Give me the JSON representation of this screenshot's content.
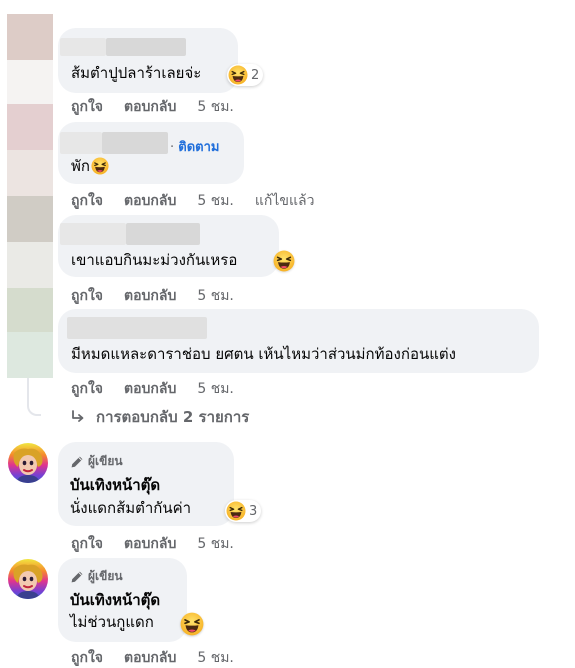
{
  "comments": [
    {
      "text": "ส้มตำปูปลาร้าเลยจ่ะ",
      "reaction_count": "2",
      "like": "ถูกใจ",
      "reply": "ตอบกลับ",
      "time": "5 ชม."
    },
    {
      "follow": "ติดตาม",
      "text": "พัก",
      "like": "ถูกใจ",
      "reply": "ตอบกลับ",
      "time": "5 ชม.",
      "edited": "แก้ไขแล้ว"
    },
    {
      "text": "เขาแอบกินมะม่วงกันเหรอ",
      "like": "ถูกใจ",
      "reply": "ตอบกลับ",
      "time": "5 ชม."
    },
    {
      "text": "มีหมดแหละดาราช่อบ ยศตน เห้นไหมว่าส่วนม่กท้องก่อนแต่ง",
      "like": "ถูกใจ",
      "reply": "ตอบกลับ",
      "time": "5 ชม."
    }
  ],
  "replies_link": "การตอบกลับ 2 รายการ",
  "page_comments": [
    {
      "author_badge": "ผู้เขียน",
      "name": "บันเทิงหน้าตุ๊ด",
      "text": "นั่งแดกส้มตำกันค่า",
      "reaction_count": "3",
      "like": "ถูกใจ",
      "reply": "ตอบกลับ",
      "time": "5 ชม."
    },
    {
      "author_badge": "ผู้เขียน",
      "name": "บันเทิงหน้าตุ๊ด",
      "text": "ไม่ช่วนกูแดก",
      "like": "ถูกใจ",
      "reply": "ตอบกลับ",
      "time": "5 ชม."
    }
  ],
  "colors": {
    "bubble": "#f0f2f5",
    "meta_text": "#65676b",
    "follow_link": "#216fdb",
    "thread_line": "#e4e6eb"
  },
  "icons": [
    "laughing-emoji-icon",
    "reply-arrow-icon",
    "pencil-icon"
  ]
}
